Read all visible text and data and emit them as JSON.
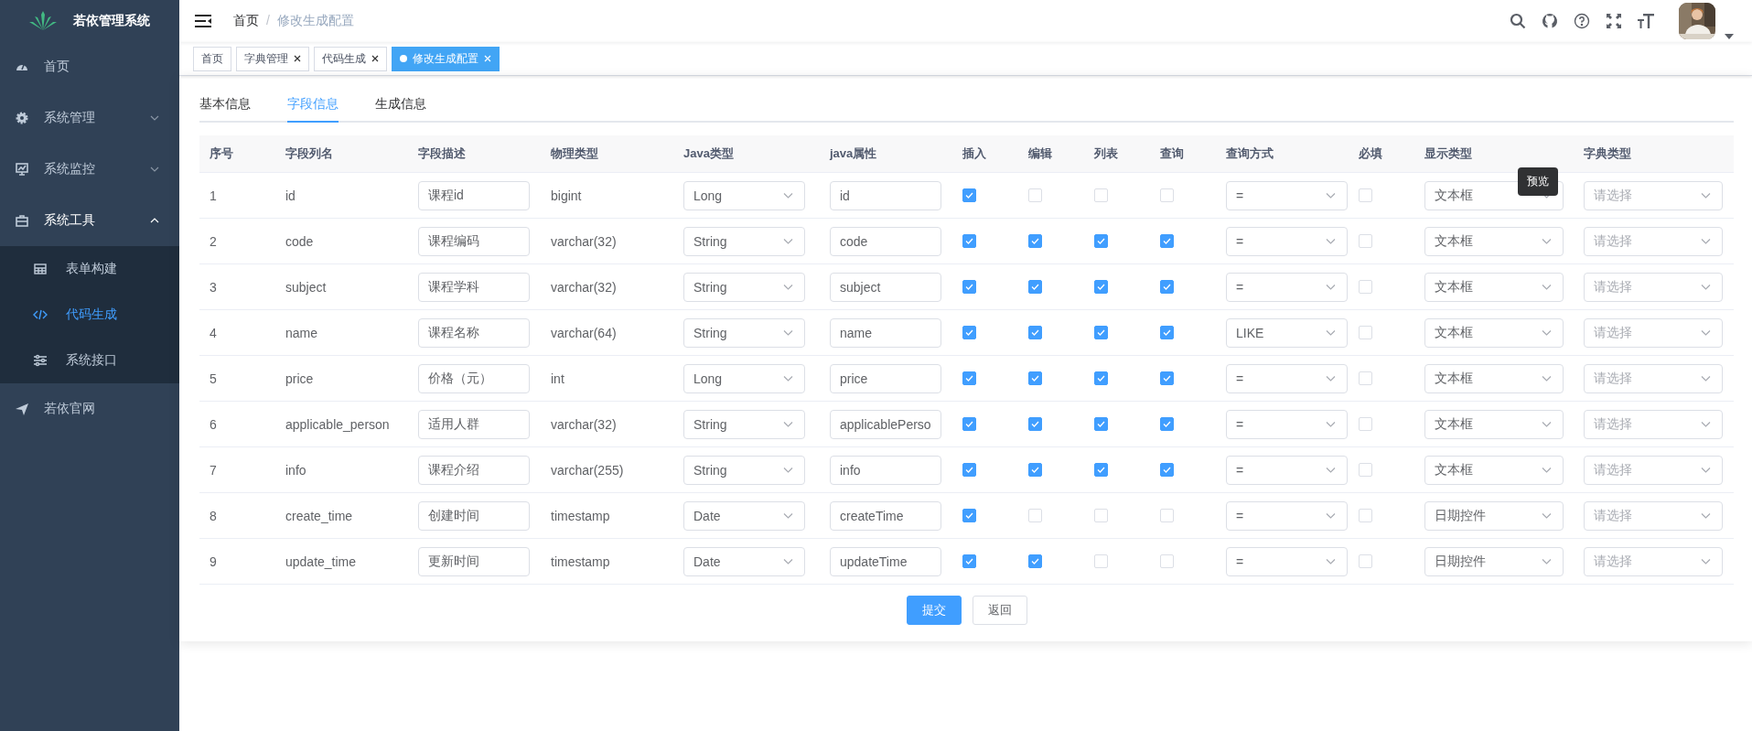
{
  "app": {
    "title": "若依管理系统"
  },
  "sidebar": {
    "items": [
      {
        "label": "首页",
        "selected": false
      },
      {
        "label": "系统管理",
        "selected": false,
        "expanded": false
      },
      {
        "label": "系统监控",
        "selected": false,
        "expanded": false
      },
      {
        "label": "系统工具",
        "selected": false,
        "expanded": true,
        "children": [
          {
            "label": "表单构建",
            "selected": false
          },
          {
            "label": "代码生成",
            "selected": true
          },
          {
            "label": "系统接口",
            "selected": false
          }
        ]
      },
      {
        "label": "若依官网",
        "selected": false
      }
    ]
  },
  "breadcrumb": [
    "首页",
    "修改生成配置"
  ],
  "breadcrumb_separator": "/",
  "tags": [
    {
      "label": "首页",
      "selected": false,
      "closable": false
    },
    {
      "label": "字典管理",
      "selected": false,
      "closable": true
    },
    {
      "label": "代码生成",
      "selected": false,
      "closable": true
    },
    {
      "label": "修改生成配置",
      "selected": true,
      "closable": true
    }
  ],
  "tabs": [
    {
      "label": "基本信息",
      "selected": false
    },
    {
      "label": "字段信息",
      "selected": true
    },
    {
      "label": "生成信息",
      "selected": false
    }
  ],
  "table": {
    "columns": [
      "序号",
      "字段列名",
      "字段描述",
      "物理类型",
      "Java类型",
      "java属性",
      "插入",
      "编辑",
      "列表",
      "查询",
      "查询方式",
      "必填",
      "显示类型",
      "字典类型"
    ],
    "rows": [
      {
        "index": "1",
        "column_name": "id",
        "description": "课程id",
        "physical_type": "bigint",
        "java_type": "Long",
        "java_field": "id",
        "insert": true,
        "edit": false,
        "list": false,
        "query": false,
        "query_type": "=",
        "required": false,
        "html_type": "文本框",
        "dict_type": {
          "placeholder": "请选择"
        }
      },
      {
        "index": "2",
        "column_name": "code",
        "description": "课程编码",
        "physical_type": "varchar(32)",
        "java_type": "String",
        "java_field": "code",
        "insert": true,
        "edit": true,
        "list": true,
        "query": true,
        "query_type": "=",
        "required": false,
        "html_type": "文本框",
        "dict_type": {
          "placeholder": "请选择"
        }
      },
      {
        "index": "3",
        "column_name": "subject",
        "description": "课程学科",
        "physical_type": "varchar(32)",
        "java_type": "String",
        "java_field": "subject",
        "insert": true,
        "edit": true,
        "list": true,
        "query": true,
        "query_type": "=",
        "required": false,
        "html_type": "文本框",
        "dict_type": {
          "placeholder": "请选择"
        }
      },
      {
        "index": "4",
        "column_name": "name",
        "description": "课程名称",
        "physical_type": "varchar(64)",
        "java_type": "String",
        "java_field": "name",
        "insert": true,
        "edit": true,
        "list": true,
        "query": true,
        "query_type": "LIKE",
        "required": false,
        "html_type": "文本框",
        "dict_type": {
          "placeholder": "请选择"
        }
      },
      {
        "index": "5",
        "column_name": "price",
        "description": "价格（元）",
        "physical_type": "int",
        "java_type": "Long",
        "java_field": "price",
        "insert": true,
        "edit": true,
        "list": true,
        "query": true,
        "query_type": "=",
        "required": false,
        "html_type": "文本框",
        "dict_type": {
          "placeholder": "请选择"
        }
      },
      {
        "index": "6",
        "column_name": "applicable_person",
        "description": "适用人群",
        "physical_type": "varchar(32)",
        "java_type": "String",
        "java_field": "applicablePerso",
        "insert": true,
        "edit": true,
        "list": true,
        "query": true,
        "query_type": "=",
        "required": false,
        "html_type": "文本框",
        "dict_type": {
          "placeholder": "请选择"
        }
      },
      {
        "index": "7",
        "column_name": "info",
        "description": "课程介绍",
        "physical_type": "varchar(255)",
        "java_type": "String",
        "java_field": "info",
        "insert": true,
        "edit": true,
        "list": true,
        "query": true,
        "query_type": "=",
        "required": false,
        "html_type": "文本框",
        "dict_type": {
          "placeholder": "请选择"
        }
      },
      {
        "index": "8",
        "column_name": "create_time",
        "description": "创建时间",
        "physical_type": "timestamp",
        "java_type": "Date",
        "java_field": "createTime",
        "insert": true,
        "edit": false,
        "list": false,
        "query": false,
        "query_type": "=",
        "required": false,
        "html_type": "日期控件",
        "dict_type": {
          "placeholder": "请选择"
        }
      },
      {
        "index": "9",
        "column_name": "update_time",
        "description": "更新时间",
        "physical_type": "timestamp",
        "java_type": "Date",
        "java_field": "updateTime",
        "insert": true,
        "edit": true,
        "list": false,
        "query": false,
        "query_type": "=",
        "required": false,
        "html_type": "日期控件",
        "dict_type": {
          "placeholder": "请选择"
        }
      }
    ]
  },
  "tooltip": {
    "text": "预览"
  },
  "buttons": [
    {
      "label": "提交",
      "kind": "primary"
    },
    {
      "label": "返回",
      "kind": "default"
    }
  ]
}
